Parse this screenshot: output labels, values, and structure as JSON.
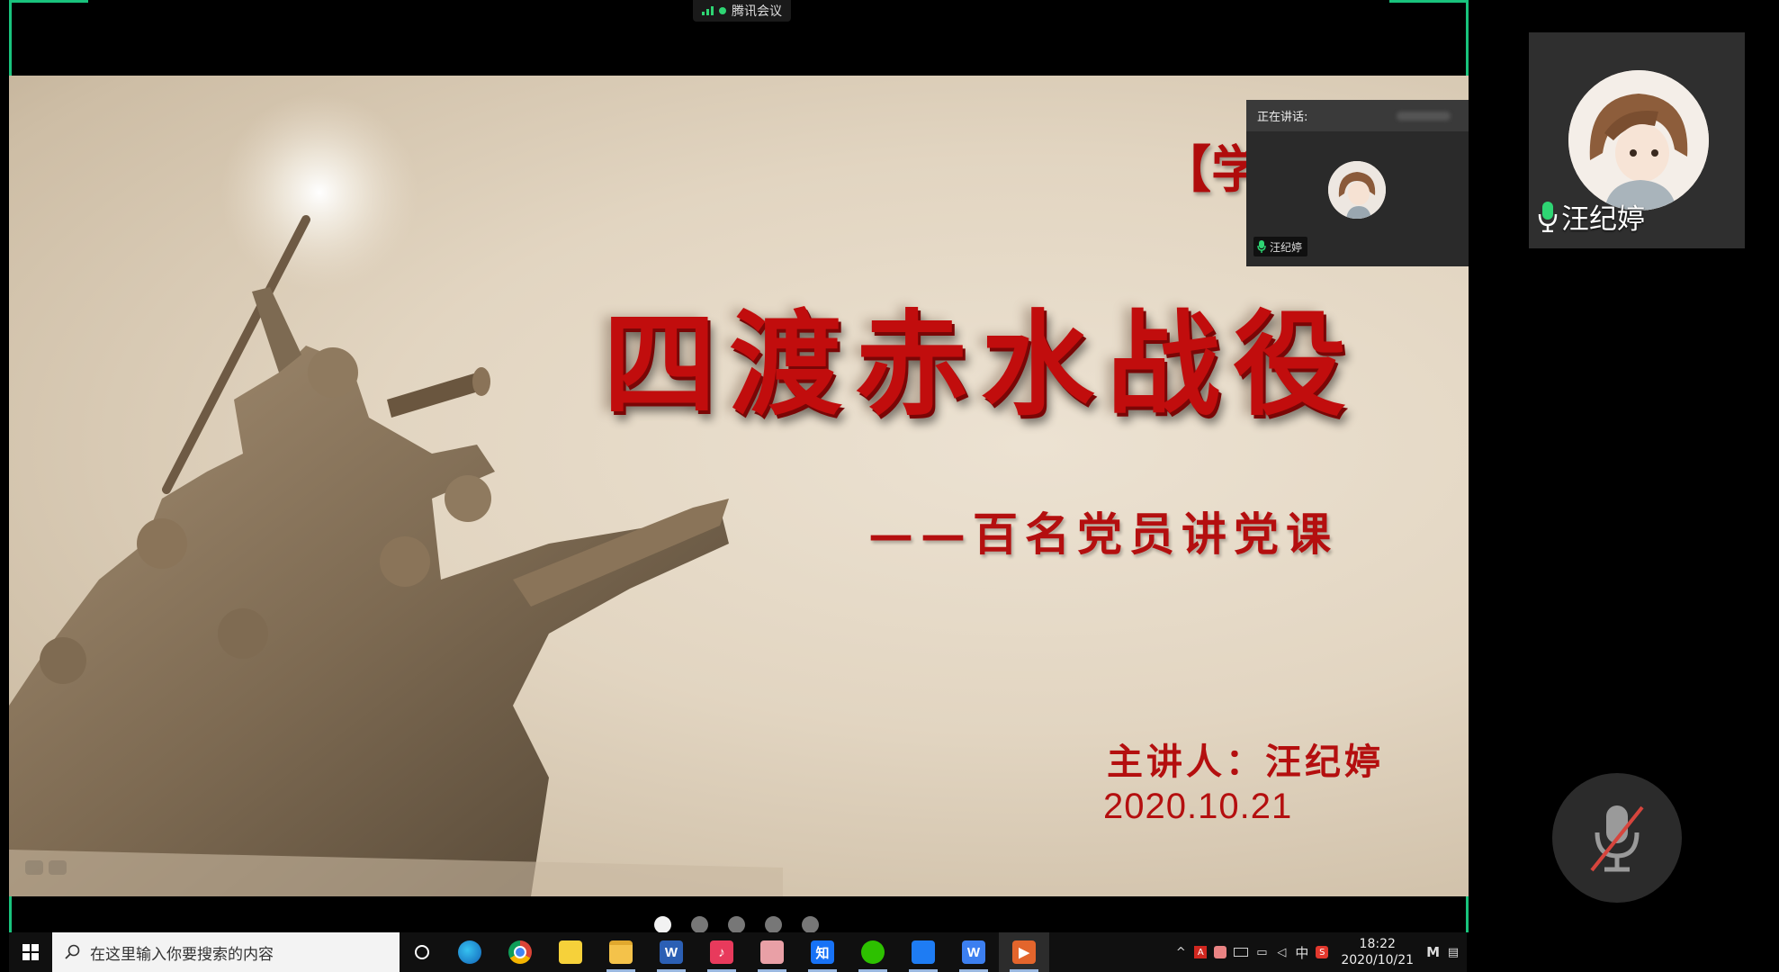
{
  "meeting": {
    "app_name": "腾讯会议"
  },
  "slide": {
    "bracket_text": "【学",
    "title": "四渡赤水战役",
    "subtitle": "——百名党员讲党课",
    "presenter": "主讲人：汪纪婷",
    "date": "2020.10.21"
  },
  "speaker_panel": {
    "header_label": "正在讲话:",
    "speaker_name": "汪纪婷"
  },
  "participant": {
    "name": "汪纪婷"
  },
  "page_dots": {
    "count": 5,
    "active_index": 0
  },
  "taskbar": {
    "search_placeholder": "在这里输入你要搜索的内容",
    "apps": [
      {
        "name": "edge",
        "label": ""
      },
      {
        "name": "chrome",
        "label": ""
      },
      {
        "name": "sticky-notes",
        "label": ""
      },
      {
        "name": "file-explorer",
        "label": ""
      },
      {
        "name": "word",
        "label": "W"
      },
      {
        "name": "music",
        "label": ""
      },
      {
        "name": "paint",
        "label": ""
      },
      {
        "name": "zhihu",
        "label": "知"
      },
      {
        "name": "wechat",
        "label": ""
      },
      {
        "name": "tencent-meeting",
        "label": ""
      },
      {
        "name": "wps-writer",
        "label": "W"
      },
      {
        "name": "wps-presentation",
        "label": ""
      }
    ],
    "tray": {
      "ime": "中",
      "time": "18:22",
      "date": "2020/10/21",
      "ime_mode": "M"
    }
  },
  "colors": {
    "accent_green": "#19c37d",
    "slide_red": "#b40f0f"
  }
}
